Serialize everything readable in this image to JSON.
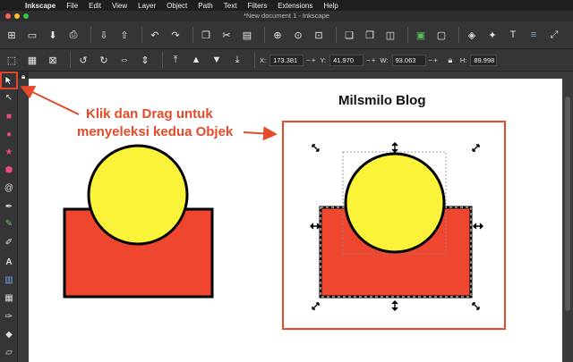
{
  "menubar": {
    "apple_icon": "apple-icon",
    "items": [
      "Inkscape",
      "File",
      "Edit",
      "View",
      "Layer",
      "Object",
      "Path",
      "Text",
      "Filters",
      "Extensions",
      "Help"
    ]
  },
  "window": {
    "title": "*New document 1 - Inkscape"
  },
  "controls": {
    "x_label": "X:",
    "x_value": "173.381",
    "y_label": "Y:",
    "y_value": "41.970",
    "w_label": "W:",
    "w_value": "93.063",
    "h_label": "H:",
    "h_value": "89.998"
  },
  "canvas": {
    "blog_title": "Milsmilo Blog",
    "annotation_line1": "Klik dan Drag untuk",
    "annotation_line2": "menyeleksi kedua Objek"
  },
  "colors": {
    "circle_fill": "#fbf33a",
    "rect_fill": "#ef462f",
    "annotation": "#e34b2a",
    "stroke": "#000000"
  }
}
